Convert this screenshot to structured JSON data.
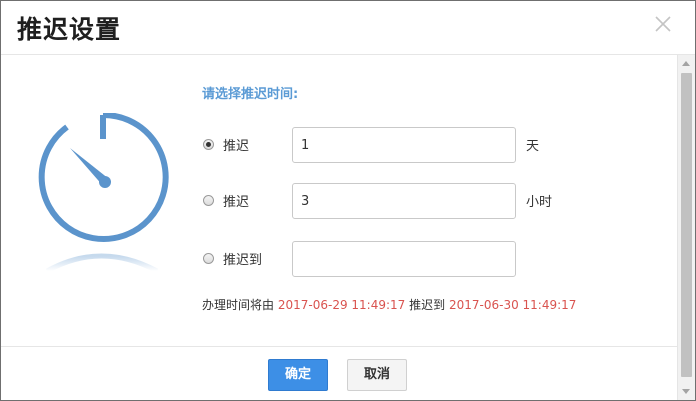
{
  "dialog": {
    "title": "推迟设置",
    "prompt": "请选择推迟时间:",
    "options": [
      {
        "label": "推迟",
        "value": "1",
        "unit": "天",
        "checked": true
      },
      {
        "label": "推迟",
        "value": "3",
        "unit": "小时",
        "checked": false
      },
      {
        "label": "推迟到",
        "value": "",
        "unit": "",
        "checked": false
      }
    ],
    "info": {
      "prefix": "办理时间将由",
      "from_time": "2017-06-29 11:49:17",
      "middle": "推迟到",
      "to_time": "2017-06-30 11:49:17"
    },
    "buttons": {
      "ok": "确定",
      "cancel": "取消"
    }
  },
  "colors": {
    "accent": "#3d8fe6",
    "icon_blue": "#5b94cc",
    "date_red": "#d9534f",
    "prompt_blue": "#5b9bd5"
  },
  "icons": {
    "close": "close-icon",
    "timer": "stopwatch-icon"
  }
}
